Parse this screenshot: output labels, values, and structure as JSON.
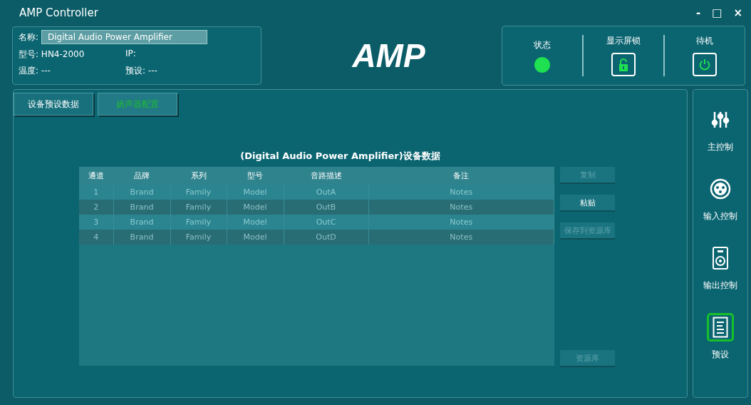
{
  "window": {
    "title": "AMP Controller",
    "controls": [
      "-",
      "□",
      "×"
    ]
  },
  "device": {
    "name_label": "名称:",
    "name_value": "Digital Audio Power Amplifier",
    "model_label": "型号:",
    "model_value": "HN4-2000",
    "ip_label": "IP:",
    "temp_label": "温度:",
    "temp_value": "---",
    "preset_label": "预设:",
    "preset_value": "---"
  },
  "logo": "AMP",
  "status_panel": {
    "status_label": "状态",
    "status_on": true,
    "lock_label": "显示屏锁",
    "locked": false,
    "standby_label": "待机"
  },
  "tabs": [
    {
      "label": "设备预设数据",
      "selected": false
    },
    {
      "label": "扬声器配置",
      "selected": true
    }
  ],
  "table": {
    "title": "(Digital Audio Power Amplifier)设备数据",
    "columns": [
      "通道",
      "品牌",
      "系列",
      "型号",
      "音路描述",
      "备注"
    ],
    "rows": [
      [
        "1",
        "Brand",
        "Family",
        "Model",
        "OutA",
        "Notes"
      ],
      [
        "2",
        "Brand",
        "Family",
        "Model",
        "OutB",
        "Notes"
      ],
      [
        "3",
        "Brand",
        "Family",
        "Model",
        "OutC",
        "Notes"
      ],
      [
        "4",
        "Brand",
        "Family",
        "Model",
        "OutD",
        "Notes"
      ]
    ]
  },
  "actions": [
    {
      "label": "复制",
      "disabled": true
    },
    {
      "label": "粘贴",
      "disabled": false
    },
    {
      "label": "保存到资源库",
      "disabled": true
    },
    {
      "label": "资源库",
      "disabled": true
    }
  ],
  "sidebar": {
    "items": [
      {
        "kind": "sliders",
        "label": "主控制",
        "selected": false
      },
      {
        "kind": "xlr",
        "label": "输入控制",
        "selected": false
      },
      {
        "kind": "speaker",
        "label": "输出控制",
        "selected": false
      },
      {
        "kind": "preset",
        "label": "预设",
        "selected": true
      }
    ]
  }
}
